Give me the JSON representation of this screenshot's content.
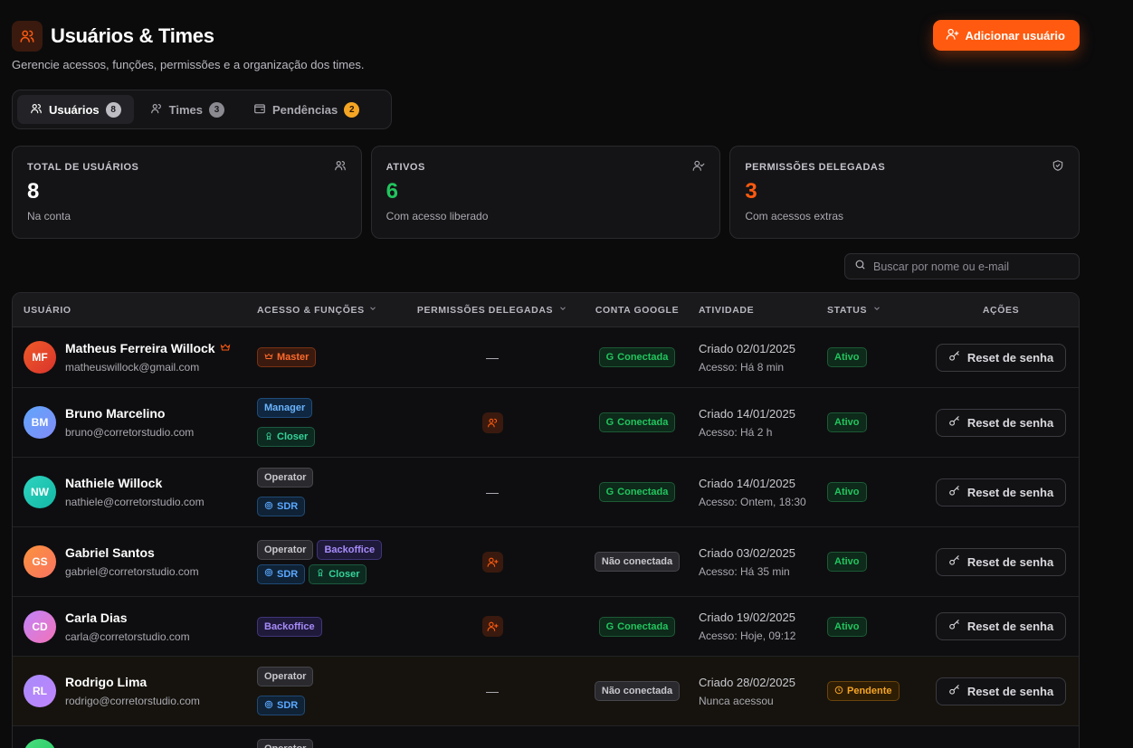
{
  "header": {
    "title": "Usuários & Times",
    "subtitle": "Gerencie acessos, funções, permissões e a organização dos times.",
    "add_button": "Adicionar usuário"
  },
  "tabs": [
    {
      "label": "Usuários",
      "count": "8"
    },
    {
      "label": "Times",
      "count": "3"
    },
    {
      "label": "Pendências",
      "count": "2"
    }
  ],
  "stats": [
    {
      "label": "TOTAL DE USUÁRIOS",
      "value": "8",
      "sub": "Na conta"
    },
    {
      "label": "ATIVOS",
      "value": "6",
      "sub": "Com acesso liberado"
    },
    {
      "label": "PERMISSÕES DELEGADAS",
      "value": "3",
      "sub": "Com acessos extras"
    }
  ],
  "search": {
    "placeholder": "Buscar por nome ou e-mail"
  },
  "table": {
    "headers": {
      "user": "USUÁRIO",
      "access": "ACESSO & FUNÇÕES",
      "perms": "PERMISSÕES DELEGADAS",
      "google": "CONTA GOOGLE",
      "activity": "ATIVIDADE",
      "status": "STATUS",
      "actions": "AÇÕES"
    },
    "reset_label": "Reset de senha",
    "dash": "—",
    "rows": [
      {
        "initials": "MF",
        "name": "Matheus Ferreira Willock",
        "email": "matheuswillock@gmail.com",
        "tags": [
          "Master"
        ],
        "google": "Conectada",
        "created": "Criado 02/01/2025",
        "access": "Acesso: Há 8 min",
        "status": "Ativo"
      },
      {
        "initials": "BM",
        "name": "Bruno Marcelino",
        "email": "bruno@corretorstudio.com",
        "tags": [
          "Manager",
          "Closer"
        ],
        "google": "Conectada",
        "created": "Criado 14/01/2025",
        "access": "Acesso: Há 2 h",
        "status": "Ativo"
      },
      {
        "initials": "NW",
        "name": "Nathiele Willock",
        "email": "nathiele@corretorstudio.com",
        "tags": [
          "Operator",
          "SDR"
        ],
        "google": "Conectada",
        "created": "Criado 14/01/2025",
        "access": "Acesso: Ontem, 18:30",
        "status": "Ativo"
      },
      {
        "initials": "GS",
        "name": "Gabriel Santos",
        "email": "gabriel@corretorstudio.com",
        "tags": [
          "Operator",
          "Backoffice",
          "SDR",
          "Closer"
        ],
        "google": "Não conectada",
        "created": "Criado 03/02/2025",
        "access": "Acesso: Há 35 min",
        "status": "Ativo"
      },
      {
        "initials": "CD",
        "name": "Carla Dias",
        "email": "carla@corretorstudio.com",
        "tags": [
          "Backoffice"
        ],
        "google": "Conectada",
        "created": "Criado 19/02/2025",
        "access": "Acesso: Hoje, 09:12",
        "status": "Ativo"
      },
      {
        "initials": "RL",
        "name": "Rodrigo Lima",
        "email": "rodrigo@corretorstudio.com",
        "tags": [
          "Operator",
          "SDR"
        ],
        "google": "Não conectada",
        "created": "Criado 28/02/2025",
        "access": "Nunca acessou",
        "status": "Pendente"
      },
      {
        "initials": "",
        "name": "",
        "email": "",
        "tags": [
          "Operator"
        ],
        "google": "",
        "created": "",
        "access": "",
        "status": ""
      }
    ]
  },
  "colors": {
    "accent": "#ff5a0f",
    "green": "#22c55e",
    "amber": "#f5a524"
  }
}
